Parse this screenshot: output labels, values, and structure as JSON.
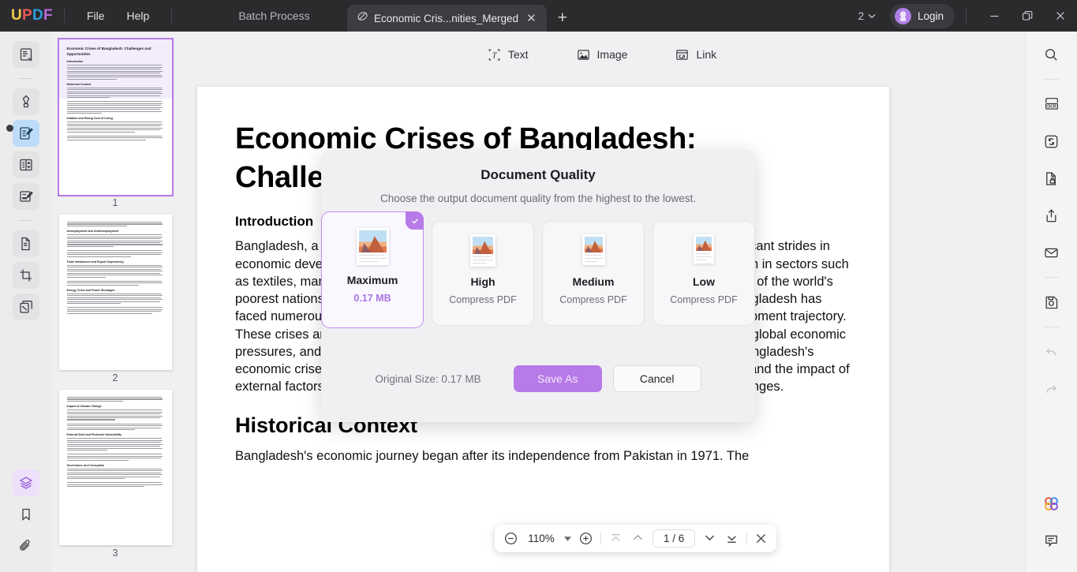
{
  "titlebar": {
    "logo": "UPDF",
    "menus": [
      {
        "label": "File",
        "name": "menu-file"
      },
      {
        "label": "Help",
        "name": "menu-help"
      }
    ],
    "batch_process": "Batch Process",
    "tab": {
      "title": "Economic Cris...nities_Merged",
      "close": "✕",
      "icon": "pdf-doc-icon"
    },
    "new_tab": "+",
    "page_count": "2",
    "page_count_caret": "⌄",
    "login": "Login",
    "window": {
      "minimize": "—",
      "maximize": "❐",
      "close": "✕"
    }
  },
  "left_rail": {
    "items": [
      {
        "name": "sidebar-reader-icon",
        "title": "Reader"
      },
      {
        "name": "sidebar-highlighter-icon",
        "title": "Highlighter"
      },
      {
        "name": "sidebar-edit-pdf-icon",
        "title": "Edit PDF"
      },
      {
        "name": "sidebar-organize-pages-icon",
        "title": "Organize Pages"
      },
      {
        "name": "sidebar-form-icon",
        "title": "Form"
      },
      {
        "name": "sidebar-convert-icon",
        "title": "Convert PDF"
      },
      {
        "name": "sidebar-crop-icon",
        "title": "Crop Pages"
      },
      {
        "name": "sidebar-compare-icon",
        "title": "Compare"
      }
    ],
    "bottom": [
      {
        "name": "sidebar-layers-icon",
        "title": "Layers"
      },
      {
        "name": "sidebar-bookmark-icon",
        "title": "Bookmark"
      },
      {
        "name": "sidebar-attachment-icon",
        "title": "Attachment"
      }
    ]
  },
  "thumbnails": [
    {
      "number": "1",
      "selected": true,
      "title": "Economic Crises of Bangladesh: Challenges and Opportunities",
      "headings": [
        "Introduction",
        "Historical Context",
        "Inflation and Rising Cost of Living"
      ]
    },
    {
      "number": "2",
      "selected": false,
      "title": "",
      "headings": [
        "Unemployment and Underemployment",
        "Trade Imbalances and Export Dependency",
        "Energy Crisis and Power Shortages"
      ]
    },
    {
      "number": "3",
      "selected": false,
      "title": "",
      "headings": [
        "Impact of Climate Change",
        "External Debt and Financial Vulnerability",
        "Governance and Corruption"
      ]
    }
  ],
  "object_toolbar": [
    {
      "label": "Text",
      "name": "toolbar-text"
    },
    {
      "label": "Image",
      "name": "toolbar-image"
    },
    {
      "label": "Link",
      "name": "toolbar-link"
    }
  ],
  "document": {
    "title": "Economic Crises of Bangladesh: Challenges and Opportunities",
    "heading_intro": "Introduction",
    "paragraph1": "Bangladesh, a South Asian country with a population of over 165 million, has made significant strides in economic development over the past few decades. It has experienced considerable growth in sectors such as textiles, manufacturing, remittances, and agriculture, transforming the country from one of the world's poorest nations to an emerging market economy. However, despite its achievements, Bangladesh has faced numerous economic crises that continue to pose significant challenges to its development trajectory. These crises are often the result of a complex interplay of internal structural weaknesses, global economic pressures, and socio-political instability. This essay explores the various dimensions of Bangladesh's economic crises, including inflation, unemployment, trade imbalances, energy shortages, and the impact of external factors, while also highlighting potential opportunities for overcoming these challenges.",
    "heading_history": "Historical Context",
    "paragraph2": "Bangladesh's economic journey began after its independence from Pakistan in 1971. The"
  },
  "right_rail": {
    "items": [
      {
        "name": "search-icon",
        "title": "Search"
      },
      {
        "name": "ocr-icon",
        "title": "OCR",
        "label": "OCR"
      },
      {
        "name": "compress-icon",
        "title": "Compress PDF"
      },
      {
        "name": "protect-icon",
        "title": "Protect"
      },
      {
        "name": "share-icon",
        "title": "Share"
      },
      {
        "name": "email-icon",
        "title": "Email"
      },
      {
        "name": "save-icon",
        "title": "Save"
      },
      {
        "name": "undo-icon",
        "title": "Undo"
      },
      {
        "name": "redo-icon",
        "title": "Redo"
      }
    ],
    "bottom": [
      {
        "name": "ai-assistant-icon",
        "title": "AI Assistant"
      },
      {
        "name": "comment-icon",
        "title": "Comment"
      }
    ]
  },
  "floatbar": {
    "zoom_out": "−",
    "zoom_value": "110%",
    "zoom_caret": "▾",
    "zoom_in": "+",
    "page_indicator": "1 / 6",
    "close": "✕"
  },
  "modal": {
    "title": "Document Quality",
    "subtitle": "Choose the output document quality from the highest to the lowest.",
    "cards": [
      {
        "name": "Maximum",
        "sub": "0.17 MB",
        "selected": true,
        "accent": true
      },
      {
        "name": "High",
        "sub": "Compress PDF",
        "selected": false,
        "accent": false
      },
      {
        "name": "Medium",
        "sub": "Compress PDF",
        "selected": false,
        "accent": false
      },
      {
        "name": "Low",
        "sub": "Compress PDF",
        "selected": false,
        "accent": false
      }
    ],
    "original_size": "Original Size: 0.17 MB",
    "save_as": "Save As",
    "cancel": "Cancel",
    "check_icon": "check-icon"
  },
  "colors": {
    "accent_purple": "#b77ae8",
    "titlebar_bg": "#2b2b2e",
    "app_bg": "#f0f0f2",
    "modal_bg": "#f0f0f2",
    "active_blue": "#bcdcfa"
  }
}
